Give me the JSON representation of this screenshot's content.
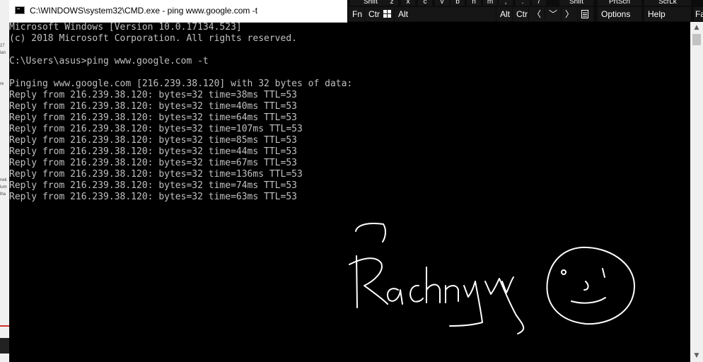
{
  "window": {
    "title": "C:\\WINDOWS\\system32\\CMD.exe - ping  www.google.com -t"
  },
  "console": {
    "lines": [
      "Microsoft Windows [Version 10.0.17134.523]",
      "(c) 2018 Microsoft Corporation. All rights reserved.",
      "",
      "C:\\Users\\asus>ping www.google.com -t",
      "",
      "Pinging www.google.com [216.239.38.120] with 32 bytes of data:",
      "Reply from 216.239.38.120: bytes=32 time=38ms TTL=53",
      "Reply from 216.239.38.120: bytes=32 time=40ms TTL=53",
      "Reply from 216.239.38.120: bytes=32 time=64ms TTL=53",
      "Reply from 216.239.38.120: bytes=32 time=107ms TTL=53",
      "Reply from 216.239.38.120: bytes=32 time=85ms TTL=53",
      "Reply from 216.239.38.120: bytes=32 time=44ms TTL=53",
      "Reply from 216.239.38.120: bytes=32 time=67ms TTL=53",
      "Reply from 216.239.38.120: bytes=32 time=136ms TTL=53",
      "Reply from 216.239.38.120: bytes=32 time=74ms TTL=53",
      "Reply from 216.239.38.120: bytes=32 time=63ms TTL=53"
    ],
    "text_color": "#c0c0c0",
    "background": "#000000"
  },
  "keyboard": {
    "top_keys": [
      "Shift",
      "z",
      "x",
      "c",
      "v",
      "b",
      "n",
      "m",
      ",",
      ".",
      "/",
      "Shift",
      "PrtScn",
      "ScrLk"
    ],
    "bottom_keys": {
      "fn": "Fn",
      "ctrl_left": "Ctr",
      "alt_left": "Alt",
      "alt_right": "Alt",
      "ctrl_right": "Ctr",
      "left_arrow": "〈",
      "down_arrow": "﹀",
      "right_arrow": "〉",
      "options": "Options",
      "help": "Help",
      "fade": "Fa"
    }
  },
  "drawing": {
    "handwritten_name": "Rachnyy",
    "smiley": true,
    "stroke_color": "#ffffff"
  },
  "desktop": {
    "fragments": [
      "27",
      "lan",
      "re",
      "nek",
      "lum",
      "lha"
    ]
  }
}
